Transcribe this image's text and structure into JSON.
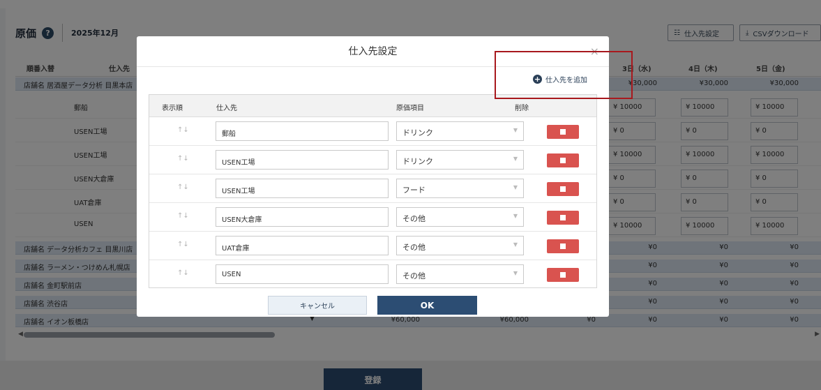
{
  "header": {
    "title": "原価",
    "help_icon": "?",
    "month": "2025年12月"
  },
  "toolbar": {
    "supplier_settings_label": "仕入先設定",
    "csv_download_label": "CSVダウンロード"
  },
  "grid": {
    "columns": {
      "reorder": "順番入替",
      "supplier": "仕入先",
      "day3": "3日（水)",
      "day4": "4日（木)",
      "day5": "5日（金)"
    },
    "store_rows": [
      {
        "name": "店舗名 居酒屋データ分析 目黒本店",
        "d3": "¥30,000",
        "d4": "¥30,000",
        "d5": "¥30,000"
      },
      {
        "name": "店舗名 データ分析カフェ 目黒川店",
        "d3": "¥0",
        "d4": "¥0",
        "d5": "¥0"
      },
      {
        "name": "店舗名 ラーメン・つけめん札幌店",
        "d3": "¥0",
        "d4": "¥0",
        "d5": "¥0"
      },
      {
        "name": "店舗名 金町駅前店",
        "d3": "¥0",
        "d4": "¥0",
        "d5": "¥0"
      },
      {
        "name": "店舗名 渋谷店",
        "d3": "¥0",
        "d4": "¥0",
        "d5": "¥0"
      },
      {
        "name": "店舗名 イオン板橋店",
        "t1": "¥60,000",
        "t2": "¥60,000",
        "t3": "¥0",
        "d3": "¥0",
        "d4": "¥0",
        "d5": "¥0"
      }
    ],
    "supplier_rows": [
      {
        "name": "郵船",
        "d3": "¥ 10000",
        "d4": "¥ 10000",
        "d5": "¥ 10000"
      },
      {
        "name": "USEN工場",
        "d3": "¥ 0",
        "d4": "¥ 0",
        "d5": "¥ 0"
      },
      {
        "name": "USEN工場",
        "d3": "¥ 10000",
        "d4": "¥ 10000",
        "d5": "¥ 10000"
      },
      {
        "name": "USEN大倉庫",
        "d3": "¥ 0",
        "d4": "¥ 0",
        "d5": "¥ 0"
      },
      {
        "name": "UAT倉庫",
        "d3": "¥ 0",
        "d4": "¥ 0",
        "d5": "¥ 0"
      },
      {
        "name": "USEN",
        "d3": "¥ 10000",
        "d4": "¥ 10000",
        "d5": "¥ 10000"
      }
    ]
  },
  "footer": {
    "save_label": "登録"
  },
  "modal": {
    "title": "仕入先設定",
    "close": "×",
    "add_label": "仕入先を追加",
    "columns": {
      "order": "表示順",
      "supplier": "仕入先",
      "category": "原価項目",
      "delete": "削除"
    },
    "rows": [
      {
        "supplier": "郵船",
        "category": "ドリンク"
      },
      {
        "supplier": "USEN工場",
        "category": "ドリンク"
      },
      {
        "supplier": "USEN工場",
        "category": "フード"
      },
      {
        "supplier": "USEN大倉庫",
        "category": "その他"
      },
      {
        "supplier": "UAT倉庫",
        "category": "その他"
      },
      {
        "supplier": "USEN",
        "category": "その他"
      }
    ],
    "cancel_label": "キャンセル",
    "ok_label": "OK"
  },
  "colors": {
    "accent": "#2c4d73",
    "delete": "#d9534f",
    "highlight": "#a8181d",
    "store_row": "#dfe9f4"
  }
}
